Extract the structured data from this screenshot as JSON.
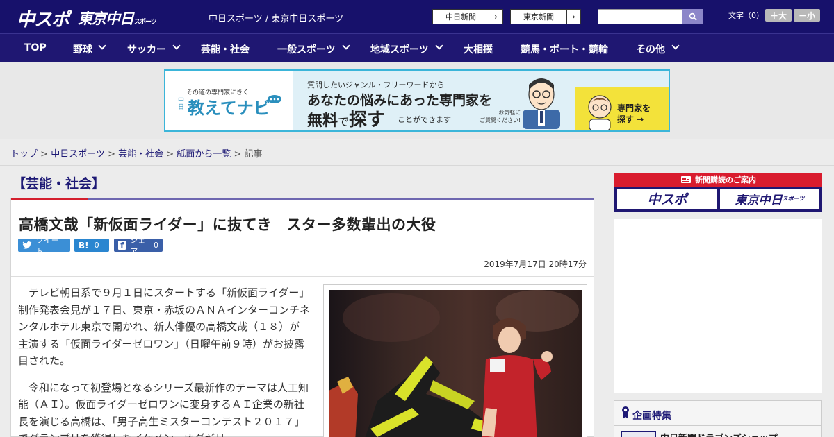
{
  "header": {
    "logo_chunichi": "中スポ",
    "logo_tokyo": "東京中日",
    "logo_tokyo_small": "スポーツ",
    "site_name": "中日スポーツ / 東京中日スポーツ",
    "paper_links": [
      {
        "label": "中日新聞",
        "arrow": "›"
      },
      {
        "label": "東京新聞",
        "arrow": "›"
      }
    ],
    "search_placeholder": "",
    "font_size_label": "文字（0）",
    "font_larger": "＋大",
    "font_smaller": "－小"
  },
  "nav": {
    "items": [
      {
        "label": "TOP",
        "has_dropdown": false
      },
      {
        "label": "野球",
        "has_dropdown": true
      },
      {
        "label": "サッカー",
        "has_dropdown": true
      },
      {
        "label": "芸能・社会",
        "has_dropdown": false
      },
      {
        "label": "一般スポーツ",
        "has_dropdown": true
      },
      {
        "label": "地域スポーツ",
        "has_dropdown": true
      },
      {
        "label": "大相撲",
        "has_dropdown": false
      },
      {
        "label": "競馬・ボート・競輪",
        "has_dropdown": false
      },
      {
        "label": "その他",
        "has_dropdown": true
      }
    ]
  },
  "banner": {
    "tagline_small": "その道の専門家にきく",
    "brand_prefix": "中日",
    "brand": "教えてナビ",
    "line1": "質問したいジャンル・フリーワードから",
    "line2": "あなたの悩みにあった専門家を",
    "line3a": "無料",
    "line3b": "で",
    "line3c": "探す",
    "line4": "ことができます",
    "note": "お気軽に\nご質問ください!",
    "cta": "専門家を\n探す →"
  },
  "breadcrumb": {
    "items": [
      "トップ",
      "中日スポーツ",
      "芸能・社会",
      "紙面から一覧"
    ],
    "current": "記事",
    "separator": ">"
  },
  "article": {
    "category": "【芸能・社会】",
    "title": "高橋文哉「新仮面ライダー」に抜てき　スター多数輩出の大役",
    "share": {
      "tweet": "ツイート",
      "hatena": "B!",
      "hatena_count": "0",
      "facebook": "シェア",
      "facebook_count": "0"
    },
    "date": "2019年7月17日 20時17分",
    "paragraphs": [
      "テレビ朝日系で９月１日にスタートする「新仮面ライダー」制作発表会見が１７日、東京・赤坂のＡＮＡインターコンチネンタルホテル東京で開かれ、新人俳優の高橋文哉（１８）が主演する「仮面ライダーゼロワン」（日曜午前９時）がお披露目された。",
      "令和になって初登場となるシリーズ最新作のテーマは人工知能（ＡＩ）。仮面ライダーゼロワンに変身するＡＩ企業の新社長を演じる高橋は、「男子高生ミスターコンテスト２０１７」でグランプリを獲得したイケメン。オダギリ"
    ]
  },
  "sidebar": {
    "subscribe_head": "新聞購読のご案内",
    "subscribe_a": "中スポ",
    "subscribe_b": "東京中日",
    "subscribe_b_small": "スポーツ",
    "feature_title": "企画特集",
    "feature_item": "中日新聞ドラゴンズショップ"
  },
  "colors": {
    "header_bg": "#17116b",
    "nav_bg": "#1f1772",
    "accent_red": "#d41f2d",
    "link": "#1d1975"
  }
}
